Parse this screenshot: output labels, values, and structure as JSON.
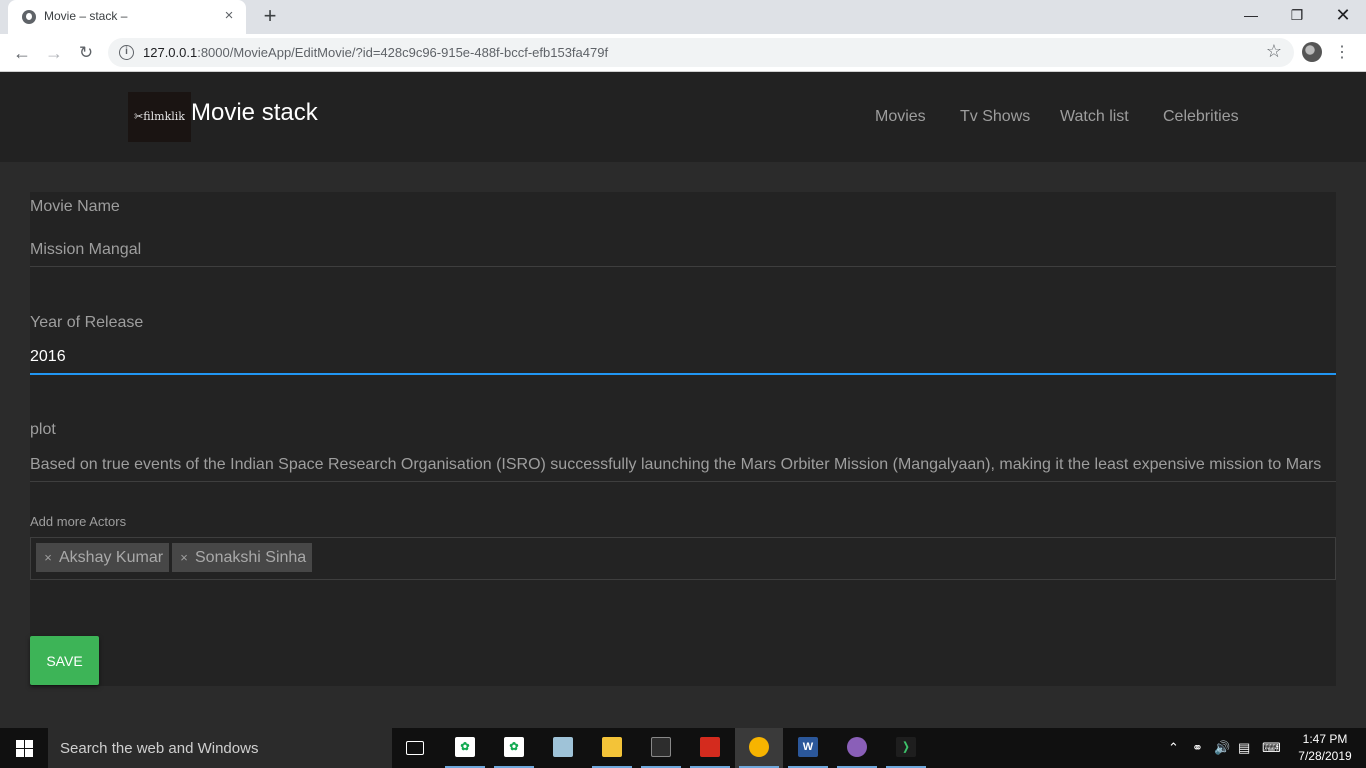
{
  "browser": {
    "tab_title": "Movie – stack –",
    "tab_close": "×",
    "new_tab": "+",
    "url_host": "127.0.0.1",
    "url_rest": ":8000/MovieApp/EditMovie/?id=428c9c96-915e-488f-bccf-efb153fa479f",
    "controls": {
      "minimize": "—",
      "maximize": "❐",
      "close": "✕"
    }
  },
  "site": {
    "logo_text": "✂filmklik",
    "brand": "Movie stack",
    "nav": [
      "Movies",
      "Tv Shows",
      "Watch list",
      "Celebrities"
    ]
  },
  "form": {
    "movie_name_label": "Movie Name",
    "movie_name_value": "Mission Mangal",
    "year_label": "Year of Release",
    "year_value": "2016",
    "plot_label": "plot",
    "plot_value": "Based on true events of the Indian Space Research Organisation (ISRO) successfully launching the Mars Orbiter Mission (Mangalyaan), making it the least expensive mission to Mars",
    "actors_label": "Add more Actors",
    "actors": [
      {
        "remove": "×",
        "name": "Akshay Kumar"
      },
      {
        "remove": "×",
        "name": "Sonakshi Sinha"
      }
    ],
    "save_label": "SAVE"
  },
  "taskbar": {
    "search_placeholder": "Search the web and Windows",
    "time": "1:47 PM",
    "date": "7/28/2019"
  },
  "colors": {
    "navbar_bg": "#222222",
    "page_bg": "#2b2b2b",
    "panel_bg": "#232323",
    "focus_underline": "#2196f3",
    "save_button": "#3db457"
  }
}
